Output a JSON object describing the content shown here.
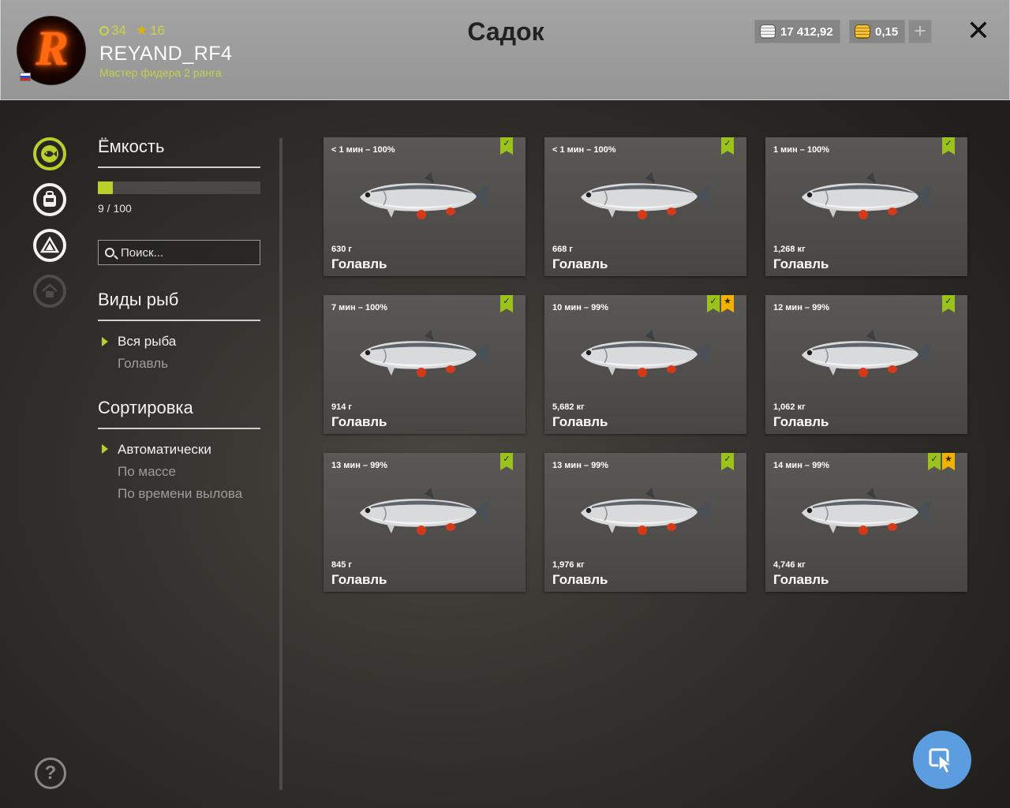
{
  "header": {
    "title": "Садок",
    "player": {
      "name": "REYAND_RF4",
      "rank": "Мастер фидера 2 ранга",
      "level": "34",
      "stars": "16",
      "avatar_letter": "R"
    },
    "silver": "17 412,92",
    "gold": "0,15",
    "add_label": "+",
    "close_label": "✕"
  },
  "rail": {
    "icons": [
      "fish-icon",
      "backpack-icon",
      "tent-icon",
      "home-icon"
    ]
  },
  "capacity": {
    "heading": "Ёмкость",
    "text": "9 / 100",
    "fill_fraction": 0.09
  },
  "search": {
    "placeholder": "Поиск..."
  },
  "species": {
    "heading": "Виды рыб",
    "items": [
      "Вся рыба",
      "Голавль"
    ]
  },
  "sorting": {
    "heading": "Сортировка",
    "items": [
      "Автоматически",
      "По массе",
      "По времени вылова"
    ]
  },
  "fish": [
    {
      "time": "< 1 мин – 100%",
      "weight": "630 г",
      "name": "Голавль",
      "check": true,
      "star": false
    },
    {
      "time": "< 1 мин – 100%",
      "weight": "668 г",
      "name": "Голавль",
      "check": true,
      "star": false
    },
    {
      "time": "1 мин – 100%",
      "weight": "1,268 кг",
      "name": "Голавль",
      "check": true,
      "star": false
    },
    {
      "time": "7 мин – 100%",
      "weight": "914 г",
      "name": "Голавль",
      "check": true,
      "star": false
    },
    {
      "time": "10 мин – 99%",
      "weight": "5,682 кг",
      "name": "Голавль",
      "check": true,
      "star": true
    },
    {
      "time": "12 мин – 99%",
      "weight": "1,062 кг",
      "name": "Голавль",
      "check": true,
      "star": false
    },
    {
      "time": "13 мин – 99%",
      "weight": "845 г",
      "name": "Голавль",
      "check": true,
      "star": false
    },
    {
      "time": "13 мин – 99%",
      "weight": "1,976 кг",
      "name": "Голавль",
      "check": true,
      "star": false
    },
    {
      "time": "14 мин – 99%",
      "weight": "4,746 кг",
      "name": "Голавль",
      "check": true,
      "star": true
    }
  ],
  "help_label": "?",
  "colors": {
    "accent": "#b9cf2c",
    "gold": "#f0b400",
    "cursor_button": "#5c9de0"
  }
}
